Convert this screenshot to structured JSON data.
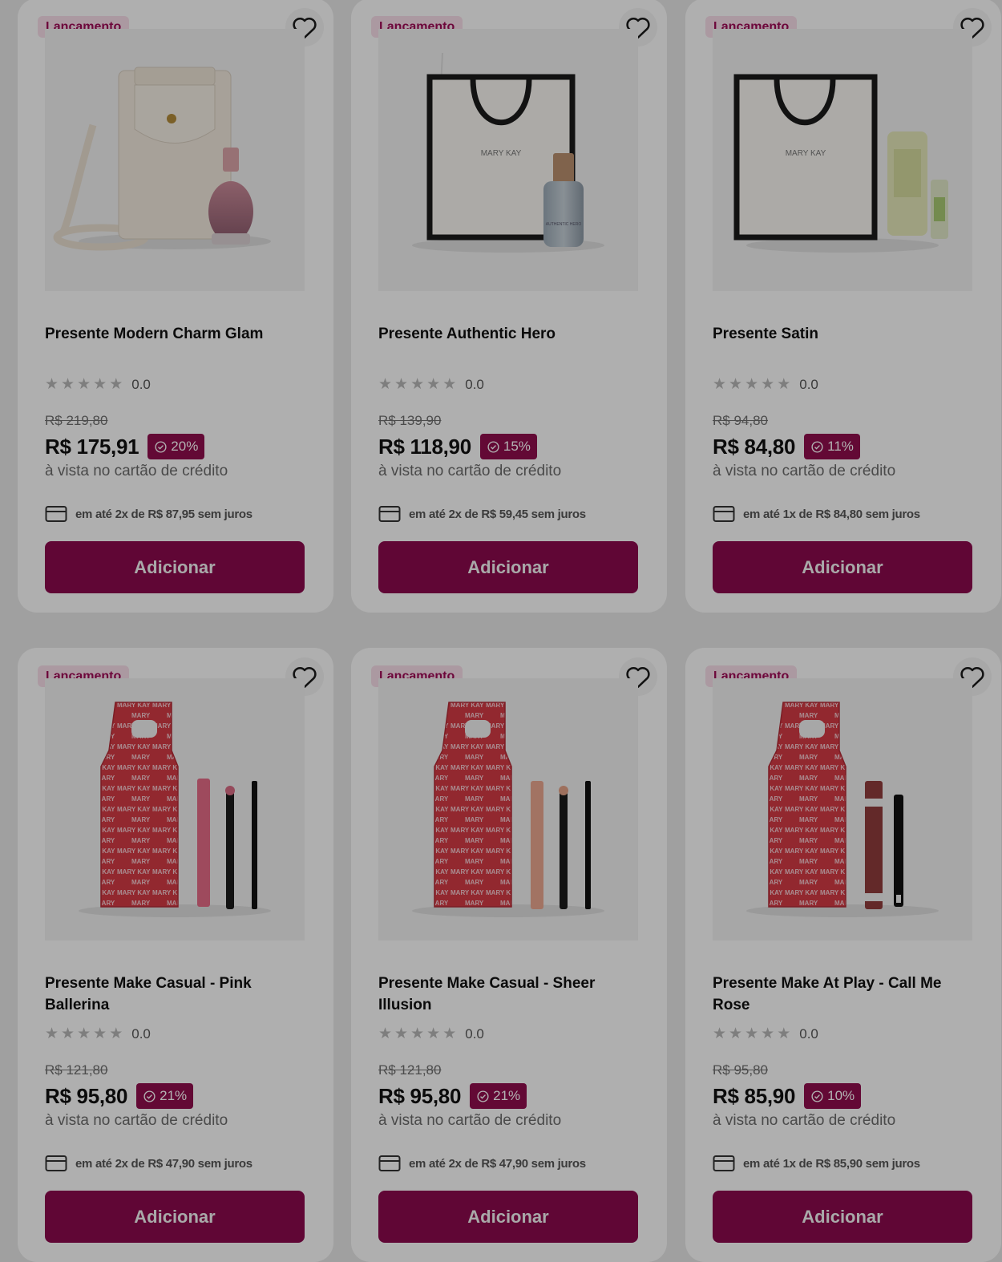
{
  "products": [
    {
      "badge": "Lançamento",
      "name": "Presente Modern Charm Glam",
      "rating": "0.0",
      "old_price": "R$ 219,80",
      "price": "R$ 175,91",
      "discount": "20%",
      "payment_note": "à vista no cartão de crédito",
      "installment": "em até 2x de R$ 87,95 sem juros",
      "button": "Adicionar"
    },
    {
      "badge": "Lançamento",
      "name": "Presente Authentic Hero",
      "rating": "0.0",
      "old_price": "R$ 139,90",
      "price": "R$ 118,90",
      "discount": "15%",
      "payment_note": "à vista no cartão de crédito",
      "installment": "em até 2x de R$ 59,45 sem juros",
      "button": "Adicionar"
    },
    {
      "badge": "Lançamento",
      "name": "Presente Satin",
      "rating": "0.0",
      "old_price": "R$ 94,80",
      "price": "R$ 84,80",
      "discount": "11%",
      "payment_note": "à vista no cartão de crédito",
      "installment": "em até 1x de R$ 84,80 sem juros",
      "button": "Adicionar"
    },
    {
      "badge": "Lançamento",
      "name": "Presente Make Casual - Pink Ballerina",
      "rating": "0.0",
      "old_price": "R$ 121,80",
      "price": "R$ 95,80",
      "discount": "21%",
      "payment_note": "à vista no cartão de crédito",
      "installment": "em até 2x de R$ 47,90 sem juros",
      "button": "Adicionar"
    },
    {
      "badge": "Lançamento",
      "name": "Presente Make Casual - Sheer Illusion",
      "rating": "0.0",
      "old_price": "R$ 121,80",
      "price": "R$ 95,80",
      "discount": "21%",
      "payment_note": "à vista no cartão de crédito",
      "installment": "em até 2x de R$ 47,90 sem juros",
      "button": "Adicionar"
    },
    {
      "badge": "Lançamento",
      "name": "Presente Make At Play - Call Me Rose",
      "rating": "0.0",
      "old_price": "R$ 95,80",
      "price": "R$ 85,90",
      "discount": "10%",
      "payment_note": "à vista no cartão de crédito",
      "installment": "em até 1x de R$ 85,90 sem juros",
      "button": "Adicionar"
    }
  ],
  "images": {
    "brand_text": "MARY KAY",
    "bottle_text": "AUTHENTIC HERO"
  },
  "colors": {
    "accent": "#8a0a4c",
    "badge_bg": "#f5dbe7",
    "badge_text": "#9c0b55",
    "gift_box": "#d23a44"
  },
  "icons": {
    "favorite": "heart-outline-icon",
    "discount": "discount-seal-icon",
    "installment": "credit-card-icon",
    "rating": "star-icon"
  }
}
